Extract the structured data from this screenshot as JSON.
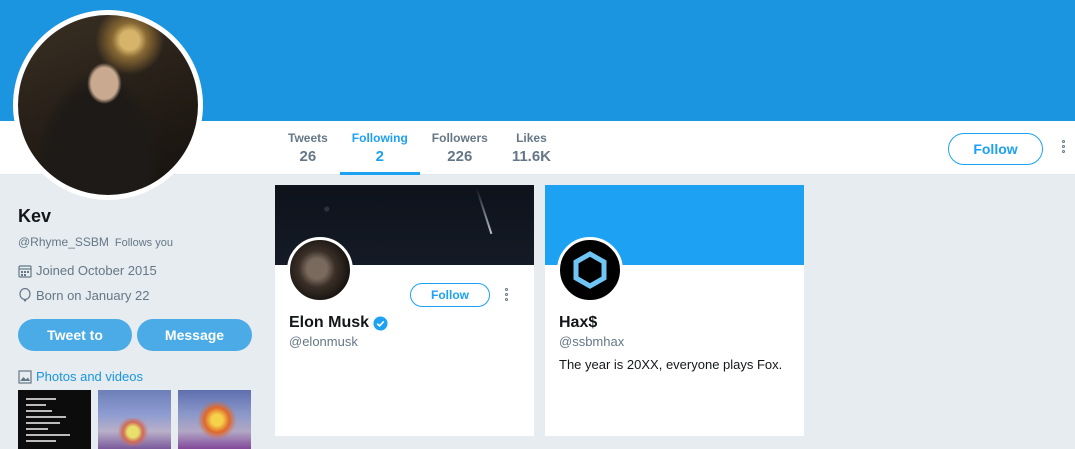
{
  "profile": {
    "name": "Kev",
    "handle": "@Rhyme_SSBM",
    "follows_you": "Follows you",
    "joined": "Joined October 2015",
    "born": "Born on January 22",
    "tweet_to_label": "Tweet to",
    "message_label": "Message",
    "photos_label": "Photos and videos"
  },
  "nav": {
    "stats": [
      {
        "label": "Tweets",
        "value": "26"
      },
      {
        "label": "Following",
        "value": "2"
      },
      {
        "label": "Followers",
        "value": "226"
      },
      {
        "label": "Likes",
        "value": "11.6K"
      }
    ],
    "follow_label": "Follow"
  },
  "cards": [
    {
      "name": "Elon Musk",
      "handle": "@elonmusk",
      "bio": "",
      "verified": true,
      "follow_label": "Follow"
    },
    {
      "name": "Hax$",
      "handle": "@ssbmhax",
      "bio": "The year is 20XX, everyone plays Fox.",
      "verified": false
    }
  ],
  "colors": {
    "banner": "#1b95e0",
    "accent": "#1da1f2",
    "pill_button": "#4aabe7",
    "background": "#e6ecf0"
  },
  "icons": [
    "calendar-icon",
    "balloon-icon",
    "photo-icon",
    "verified-badge-icon",
    "more-dots-icon",
    "hexagon-logo-icon"
  ]
}
